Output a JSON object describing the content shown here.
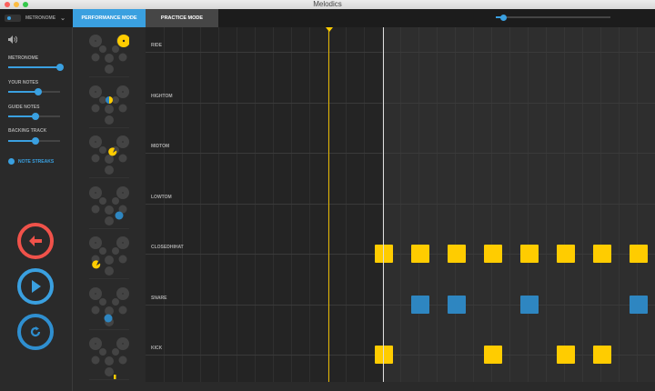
{
  "window": {
    "title": "Melodics"
  },
  "topbar": {
    "metronome_label": "METRONOME",
    "tabs": [
      {
        "label": "PERFORMANCE MODE",
        "active": true
      },
      {
        "label": "PRACTICE MODE",
        "active": false
      }
    ],
    "zoom_level": 0.04
  },
  "sidebar": {
    "volume_icon": "speaker-icon",
    "sliders": [
      {
        "label": "METRONOME",
        "value": 1.0
      },
      {
        "label": "YOUR NOTES",
        "value": 0.58
      },
      {
        "label": "GUIDE NOTES",
        "value": 0.52
      },
      {
        "label": "BACKING TRACK",
        "value": 0.52
      }
    ],
    "note_streaks_label": "NOTE STREAKS",
    "buttons": [
      {
        "name": "back",
        "icon": "arrow-left-icon",
        "color": "#f0524a"
      },
      {
        "name": "play",
        "icon": "play-icon",
        "color": "#3aa0e0"
      },
      {
        "name": "restart",
        "icon": "restart-icon",
        "color": "#2f8fd0"
      }
    ]
  },
  "colors": {
    "accent": "#3aa0e0",
    "yellow": "#ffcc00",
    "blue": "#2e86c1",
    "back": "#f0524a"
  },
  "lanes": [
    {
      "label": "RIDE",
      "notes": []
    },
    {
      "label": "HIGHTOM",
      "notes": []
    },
    {
      "label": "MIDTOM",
      "notes": []
    },
    {
      "label": "LOWTOM",
      "notes": []
    },
    {
      "label": "CLOSEDHIHAT",
      "notes": [
        {
          "beat": 0,
          "color": "yellow"
        },
        {
          "beat": 1,
          "color": "yellow"
        },
        {
          "beat": 2,
          "color": "yellow"
        },
        {
          "beat": 3,
          "color": "yellow"
        },
        {
          "beat": 4,
          "color": "yellow"
        },
        {
          "beat": 5,
          "color": "yellow"
        },
        {
          "beat": 6,
          "color": "yellow"
        },
        {
          "beat": 7,
          "color": "yellow"
        }
      ]
    },
    {
      "label": "SNARE",
      "notes": [
        {
          "beat": 1,
          "color": "blue"
        },
        {
          "beat": 2,
          "color": "blue"
        },
        {
          "beat": 4,
          "color": "blue"
        },
        {
          "beat": 7,
          "color": "blue"
        }
      ]
    },
    {
      "label": "KICK",
      "notes": [
        {
          "beat": 0,
          "color": "yellow"
        },
        {
          "beat": 3,
          "color": "yellow"
        },
        {
          "beat": 5,
          "color": "yellow"
        },
        {
          "beat": 6,
          "color": "yellow"
        }
      ]
    }
  ]
}
